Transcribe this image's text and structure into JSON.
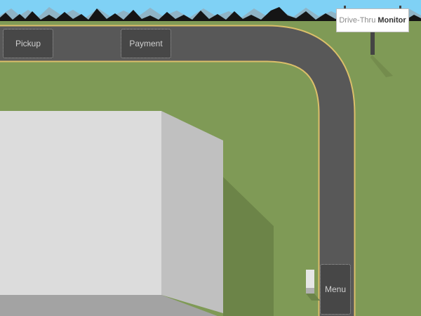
{
  "scene": {
    "title_prefix": "Drive-Thru",
    "title_emphasis": "Monitor",
    "colors": {
      "sky": "#7fd1f5",
      "grass": "#7f9a56",
      "road": "#585858",
      "road_edge": "#dcbf6a",
      "mountain": "#151515",
      "building_top": "#dcdcdc",
      "building_side": "#c0c0c0",
      "zone_fill": "#474747"
    }
  },
  "zones": {
    "pickup": "Pickup",
    "payment": "Payment",
    "menu": "Menu"
  }
}
